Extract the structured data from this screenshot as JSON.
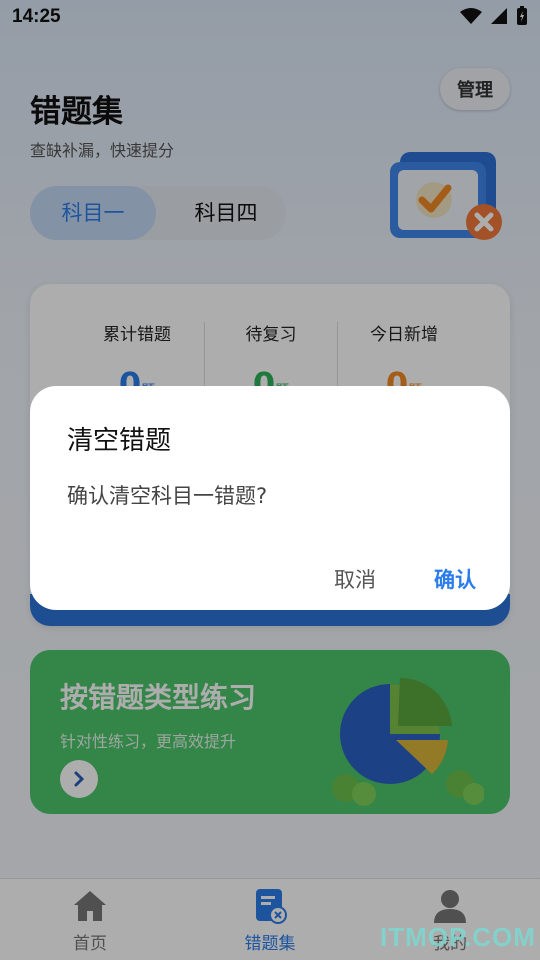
{
  "status_bar": {
    "time": "14:25"
  },
  "header": {
    "title": "错题集",
    "subtitle": "查缺补漏，快速提分",
    "manage_label": "管理"
  },
  "segments": [
    {
      "label": "科目一",
      "active": true
    },
    {
      "label": "科目四",
      "active": false
    }
  ],
  "stats": [
    {
      "label": "累计错题",
      "value": "0",
      "unit": "题",
      "color": "#2b7de9"
    },
    {
      "label": "待复习",
      "value": "0",
      "unit": "题",
      "color": "#2fb35a"
    },
    {
      "label": "今日新增",
      "value": "0",
      "unit": "题",
      "color": "#f08a24"
    }
  ],
  "practice_card": {
    "title": "按错题类型练习",
    "description": "针对性练习，更高效提升"
  },
  "tabbar": [
    {
      "label": "首页",
      "icon": "home-icon",
      "active": false
    },
    {
      "label": "错题集",
      "icon": "wrong-questions-icon",
      "active": true
    },
    {
      "label": "我的",
      "icon": "user-icon",
      "active": false
    }
  ],
  "dialog": {
    "title": "清空错题",
    "message": "确认清空科目一错题?",
    "cancel_label": "取消",
    "confirm_label": "确认"
  },
  "watermark": "ITMOP.COM",
  "colors": {
    "accent": "#2b7de9",
    "practice": "#4cc46b",
    "band": "#2d73d8"
  }
}
